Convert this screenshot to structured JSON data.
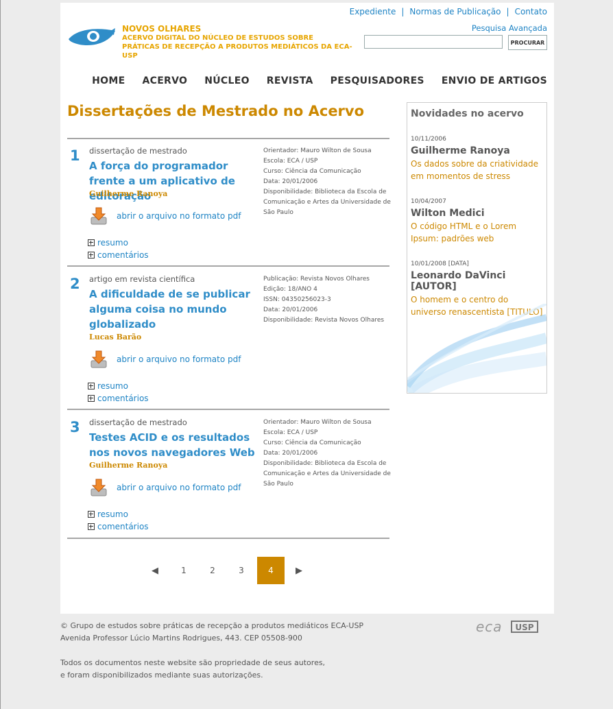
{
  "header": {
    "brand_title": "NOVOS OLHARES",
    "brand_sub_1": "ACERVO DIGITAL DO NÚCLEO DE ESTUDOS SOBRE",
    "brand_sub_2": "PRÁTICAS DE RECEPÇÃO A PRODUTOS MEDIÁTICOS DA ECA-USP",
    "top_links": [
      "Expediente",
      "Normas de Publicação",
      "Contato"
    ],
    "advanced_search": "Pesquisa Avançada",
    "search_value": "",
    "search_button": "PROCURAR"
  },
  "nav": [
    "HOME",
    "ACERVO",
    "NÚCLEO",
    "REVISTA",
    "PESQUISADORES",
    "ENVIO DE ARTIGOS"
  ],
  "main": {
    "heading": "Dissertações de Mestrado no Acervo",
    "download_label": "abrir o arquivo no formato pdf",
    "summary_label": "resumo",
    "comments_label": "comentários",
    "entries": [
      {
        "number": "1",
        "kind": "dissertação de mestrado",
        "title": "A força do programador frente a um aplicativo de editoração",
        "author": "Guilherme Ranoya",
        "meta": [
          "Orientador: Mauro Wilton de Sousa",
          "Escola: ECA / USP",
          "Curso: Ciência da Comunicação",
          "Data: 20/01/2006",
          "Disponibilidade: Biblioteca da Escola de Comunicação e Artes da Universidade de São Paulo"
        ]
      },
      {
        "number": "2",
        "kind": "artigo em revista científica",
        "title": "A dificuldade de se publicar alguma coisa no mundo globalizado",
        "author": "Lucas Barão",
        "meta": [
          "Publicação: Revista Novos Olhares",
          "Edição: 18/ANO 4",
          "ISSN: 04350256023-3",
          "Data: 20/01/2006",
          "Disponibilidade: Revista Novos Olhares"
        ]
      },
      {
        "number": "3",
        "kind": "dissertação de mestrado",
        "title": "Testes ACID e os resultados nos novos navegadores Web",
        "author": "Guilherme Ranoya",
        "meta": [
          "Orientador: Mauro Wilton de Sousa",
          "Escola: ECA / USP",
          "Curso: Ciência da Comunicação",
          "Data: 20/01/2006",
          "Disponibilidade: Biblioteca da Escola de Comunicação e Artes da Universidade de São Paulo"
        ]
      }
    ]
  },
  "pagination": {
    "prev": "◀",
    "pages": [
      "1",
      "2",
      "3",
      "4"
    ],
    "current": "4",
    "next": "▶"
  },
  "sidebar": {
    "title": "Novidades no acervo",
    "items": [
      {
        "date": "10/11/2006",
        "who": "Guilherme Ranoya",
        "what": "Os dados sobre da criatividade em momentos de stress"
      },
      {
        "date": "10/04/2007",
        "who": "Wilton Medici",
        "what": "O código HTML e o Lorem Ipsum: padrões web"
      },
      {
        "date": "10/01/2008 [DATA]",
        "who": "Leonardo DaVinci [AUTOR]",
        "what": "O homem e o centro do universo renascentista [TITULO]"
      }
    ]
  },
  "footer": {
    "line1": "© Grupo de estudos sobre práticas de recepção a produtos mediáticos ECA-USP",
    "line2": "Avenida Professor Lúcio Martins Rodrigues, 443. CEP 05508-900",
    "line3": "Todos os documentos neste website são propriedade de seus autores,",
    "line4": "e foram disponibilizados mediante suas autorizações.",
    "logo_eca": "eca",
    "logo_usp": "USP"
  },
  "colors": {
    "accent": "#cc8800",
    "link": "#1d83c4",
    "brand": "#e7a500"
  }
}
